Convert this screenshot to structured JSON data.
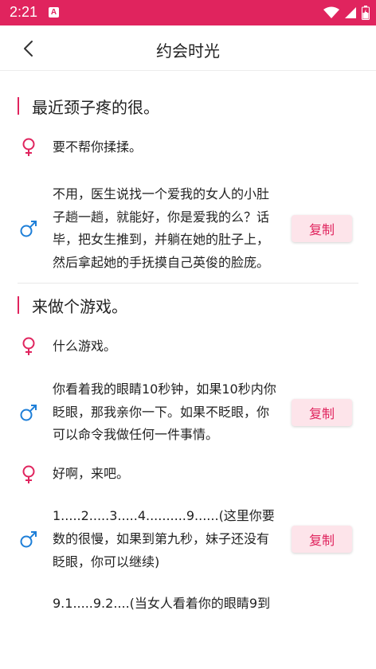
{
  "status_bar": {
    "time": "2:21",
    "notification_icon": "A",
    "colors": {
      "background": "#e0245e"
    }
  },
  "header": {
    "title": "约会时光",
    "back_icon": "chevron-left-icon"
  },
  "colors": {
    "accent": "#e0245e",
    "female_icon": "#e0245e",
    "male_icon": "#1e7fd8",
    "copy_bg": "#fde4ea"
  },
  "topics": [
    {
      "title": "最近颈子疼的很。",
      "messages": [
        {
          "gender": "female",
          "text": "要不帮你揉揉。"
        },
        {
          "gender": "male",
          "text": "不用，医生说找一个爱我的女人的小肚子趟一趟，就能好，你是爱我的么？话毕，把女生推到，并躺在她的肚子上，然后拿起她的手抚摸自己英俊的脸庞。",
          "copy_label": "复制"
        }
      ]
    },
    {
      "title": "来做个游戏。",
      "messages": [
        {
          "gender": "female",
          "text": "什么游戏。"
        },
        {
          "gender": "male",
          "text": "你看着我的眼睛10秒钟，如果10秒内你眨眼，那我亲你一下。如果不眨眼，你可以命令我做任何一件事情。",
          "copy_label": "复制"
        },
        {
          "gender": "female",
          "text": "好啊，来吧。"
        },
        {
          "gender": "male",
          "text": "1.....2.....3.....4..........9......(这里你要数的很慢，如果到第九秒，妹子还没有眨眼，你可以继续)",
          "copy_label": "复制"
        },
        {
          "gender": "male",
          "text": "9.1.....9.2....(当女人看着你的眼睛9到"
        }
      ]
    }
  ]
}
